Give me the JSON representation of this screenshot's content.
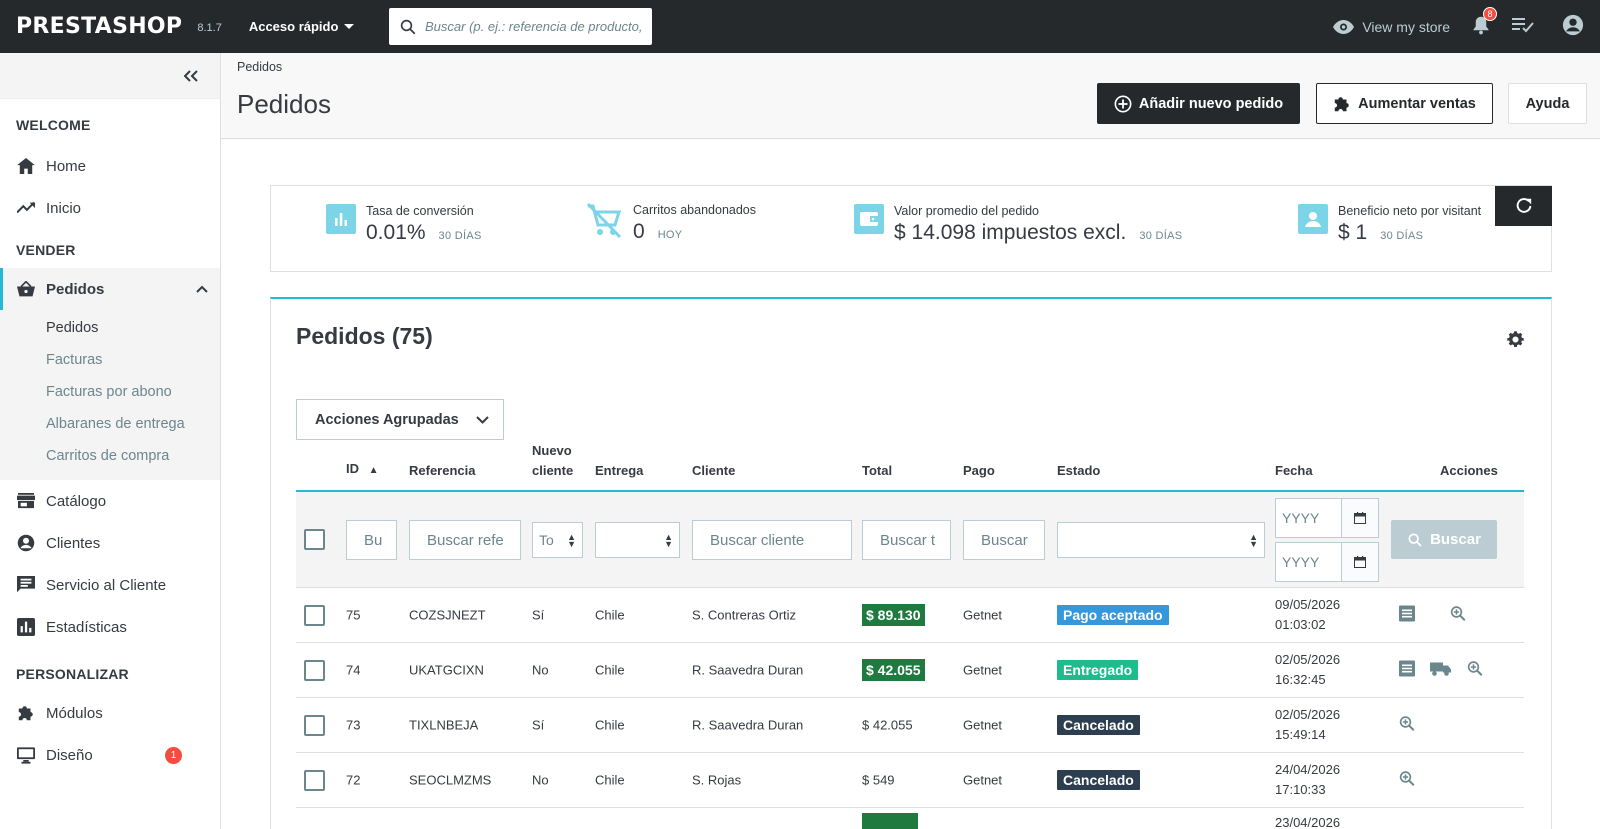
{
  "topbar": {
    "logo": "PRESTASHOP",
    "version": "8.1.7",
    "quick_access": "Acceso rápido",
    "search_placeholder": "Buscar (p. ej.: referencia de producto,",
    "view_store": "View my store",
    "notifications_count": "8"
  },
  "sidebar": {
    "sections": {
      "welcome": "WELCOME",
      "vender": "VENDER",
      "personalizar": "PERSONALIZAR"
    },
    "welcome_items": [
      {
        "label": "Home",
        "icon": "home-icon"
      },
      {
        "label": "Inicio",
        "icon": "trending-up-icon"
      }
    ],
    "pedidos": {
      "label": "Pedidos",
      "icon": "shopping-basket-icon"
    },
    "pedidos_sub": [
      "Pedidos",
      "Facturas",
      "Facturas por abono",
      "Albaranes de entrega",
      "Carritos de compra"
    ],
    "vender_items": [
      {
        "label": "Catálogo",
        "icon": "store-icon"
      },
      {
        "label": "Clientes",
        "icon": "account-circle-icon"
      },
      {
        "label": "Servicio al Cliente",
        "icon": "chat-icon"
      },
      {
        "label": "Estadísticas",
        "icon": "bar-chart-icon"
      }
    ],
    "personalizar_items": [
      {
        "label": "Módulos",
        "icon": "puzzle-icon"
      },
      {
        "label": "Diseño",
        "icon": "desktop-icon",
        "badge": "1"
      }
    ]
  },
  "header": {
    "breadcrumb": "Pedidos",
    "title": "Pedidos",
    "btn_new_order": "Añadir nuevo pedido",
    "btn_increase_sales": "Aumentar ventas",
    "btn_help": "Ayuda"
  },
  "kpis": [
    {
      "label": "Tasa de conversión",
      "value": "0.01%",
      "period": "30 DÍAS",
      "color": "#7cd5e7"
    },
    {
      "label": "Carritos abandonados",
      "value": "0",
      "period": "HOY",
      "color": "#7cd5e7"
    },
    {
      "label": "Valor promedio del pedido",
      "value": "$ 14.098 impuestos excl.",
      "period": "30 DÍAS",
      "color": "#7cd5e7"
    },
    {
      "label": "Beneficio neto por visitant",
      "value": "$ 1",
      "period": "30 DÍAS",
      "color": "#7cd5e7"
    }
  ],
  "orders": {
    "title": "Pedidos (75)",
    "bulk_actions": "Acciones Agrupadas",
    "columns": {
      "id": "ID",
      "reference": "Referencia",
      "new_client_line1": "Nuevo",
      "new_client_line2": "cliente",
      "delivery": "Entrega",
      "customer": "Cliente",
      "total": "Total",
      "payment": "Pago",
      "status": "Estado",
      "date": "Fecha",
      "actions": "Acciones"
    },
    "filters": {
      "id": "Bu",
      "reference": "Buscar refe",
      "new_client": "To",
      "customer": "Buscar cliente",
      "total": "Buscar t",
      "payment": "Buscar",
      "date_from": "YYYY",
      "date_to": "YYYY",
      "search_btn": "Buscar"
    },
    "rows": [
      {
        "id": "75",
        "ref": "COZSJNEZT",
        "new": "Sí",
        "delivery": "Chile",
        "customer": "S. Contreras Ortiz",
        "total": "$ 89.130",
        "total_highlight": true,
        "payment": "Getnet",
        "status": "Pago aceptado",
        "status_color": "#3498db",
        "date": "09/05/2026",
        "time": "01:03:02",
        "invoice": true,
        "shipping": false
      },
      {
        "id": "74",
        "ref": "UKATGCIXN",
        "new": "No",
        "delivery": "Chile",
        "customer": "R. Saavedra Duran",
        "total": "$ 42.055",
        "total_highlight": true,
        "payment": "Getnet",
        "status": "Entregado",
        "status_color": "#1cbc8c",
        "date": "02/05/2026",
        "time": "16:32:45",
        "invoice": true,
        "shipping": true
      },
      {
        "id": "73",
        "ref": "TIXLNBEJA",
        "new": "Sí",
        "delivery": "Chile",
        "customer": "R. Saavedra Duran",
        "total": "$ 42.055",
        "total_highlight": false,
        "payment": "Getnet",
        "status": "Cancelado",
        "status_color": "#2c3e50",
        "date": "02/05/2026",
        "time": "15:49:14",
        "invoice": false,
        "shipping": false
      },
      {
        "id": "72",
        "ref": "SEOCLMZMS",
        "new": "No",
        "delivery": "Chile",
        "customer": "S. Rojas",
        "total": "$ 549",
        "total_highlight": false,
        "payment": "Getnet",
        "status": "Cancelado",
        "status_color": "#2c3e50",
        "date": "24/04/2026",
        "time": "17:10:33",
        "invoice": false,
        "shipping": false
      },
      {
        "id": "",
        "ref": "",
        "new": "",
        "delivery": "",
        "customer": "",
        "total": "",
        "total_highlight": true,
        "payment": "",
        "status": "",
        "status_color": "#2c3e50",
        "date": "23/04/2026",
        "time": "",
        "invoice": false,
        "shipping": false
      }
    ]
  }
}
